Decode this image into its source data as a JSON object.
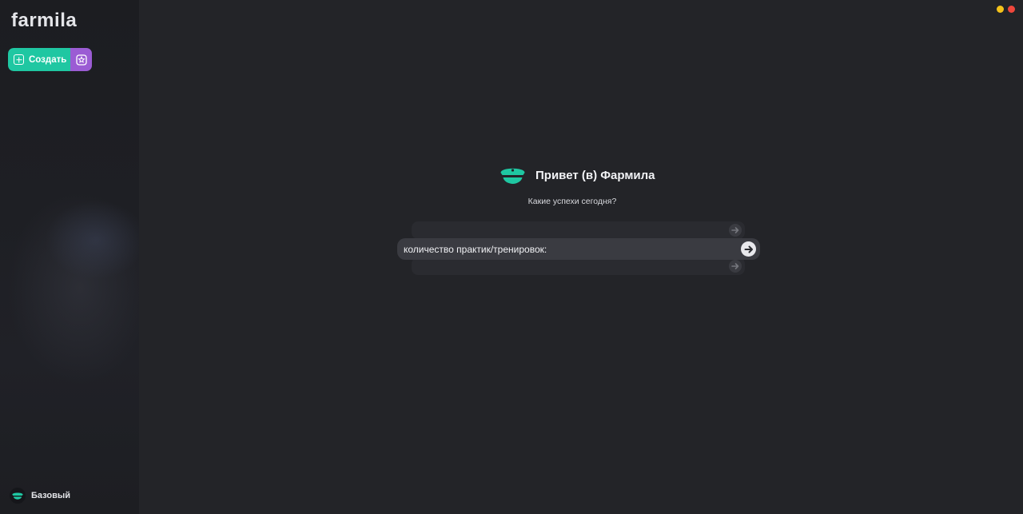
{
  "app": {
    "logo": "farmila"
  },
  "sidebar": {
    "create_label": "Создать",
    "plan_label": "Базовый"
  },
  "window_controls": [
    {
      "name": "minimize",
      "color": "#f4c21a"
    },
    {
      "name": "close",
      "color": "#f0473c"
    }
  ],
  "main": {
    "greeting_title": "Привет (в) Фармила",
    "subtitle": "Какие успехи сегодня?",
    "prompt_value": "количество практик/тренировок:"
  },
  "colors": {
    "accent_green": "#1fc7a2",
    "accent_purple": "#9b5cd4",
    "background": "#232428"
  },
  "icons": [
    "plus-square-icon",
    "star-badge-icon",
    "captain-hat-icon",
    "arrow-right-icon"
  ]
}
